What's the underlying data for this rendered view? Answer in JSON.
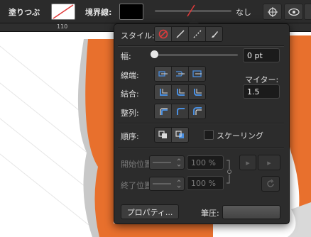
{
  "toolbar": {
    "fill_label": "塗りつぶ",
    "stroke_label": "境界線:",
    "stroke_none_label": "なし"
  },
  "ruler": {
    "mark": "110"
  },
  "popover": {
    "style_label": "スタイル:",
    "width_label": "幅:",
    "width_value": "0 pt",
    "cap_label": "線端:",
    "join_label": "結合:",
    "align_label": "整列:",
    "miter_label": "マイター:",
    "miter_value": "1.5",
    "order_label": "順序:",
    "scaling_label": "スケーリング",
    "start_label": "開始位置:",
    "end_label": "終了位置:",
    "start_scale": "100 %",
    "end_scale": "100 %",
    "properties_button": "プロパティ...",
    "brush_label": "筆圧:"
  },
  "colors": {
    "accent": "#e8702d",
    "none_red": "#e03a3a",
    "selected_blue": "#4a8fe0"
  }
}
